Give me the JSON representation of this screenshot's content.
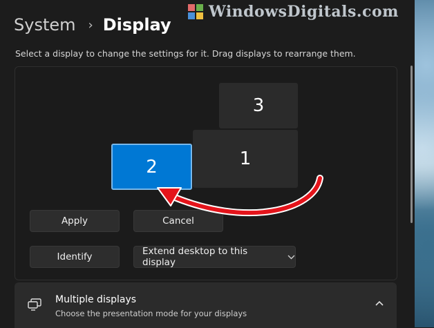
{
  "breadcrumb": {
    "parent": "System",
    "separator": "›",
    "current": "Display"
  },
  "watermark": {
    "text": "WindowsDigitals.com"
  },
  "instruction": "Select a display to change the settings for it. Drag displays to rearrange them.",
  "monitors": [
    {
      "label": "3",
      "selected": false
    },
    {
      "label": "1",
      "selected": false
    },
    {
      "label": "2",
      "selected": true
    }
  ],
  "buttons": {
    "apply": "Apply",
    "cancel": "Cancel",
    "identify": "Identify"
  },
  "display_mode_select": {
    "value": "Extend desktop to this display"
  },
  "multiple_displays": {
    "title": "Multiple displays",
    "subtitle": "Choose the presentation mode for your displays",
    "expanded": true
  },
  "colors": {
    "accent": "#0078d4",
    "annotation_arrow": "#e4141b",
    "background": "#1c1c1c",
    "card": "#2b2b2b"
  },
  "icons": [
    "chevron-right-icon",
    "chevron-down-icon",
    "chevron-up-icon",
    "multiple-displays-icon",
    "red-arrow-annotation"
  ]
}
